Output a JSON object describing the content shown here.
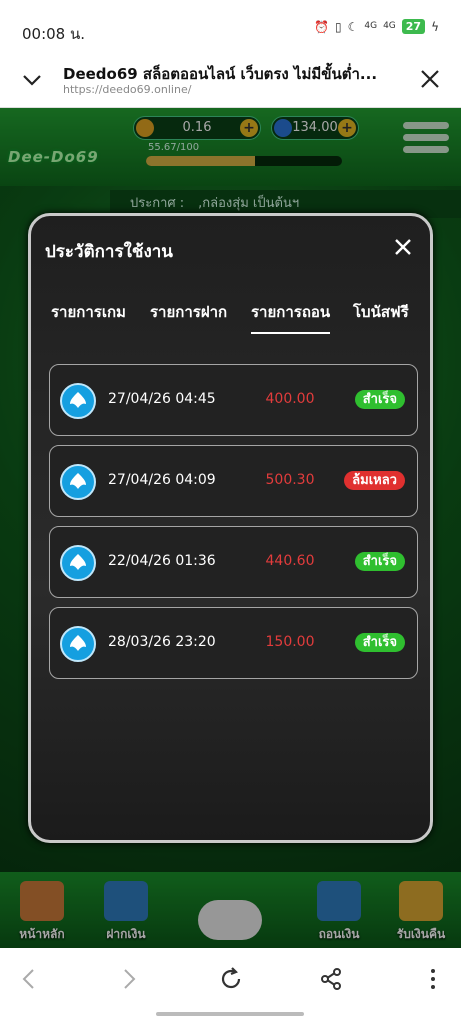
{
  "status_bar": {
    "time": "00:08 น.",
    "signal1": "4G",
    "signal2": "4G",
    "battery": "27"
  },
  "browser": {
    "page_title": "Deedo69 สล็อตออนไลน์ เว็บตรง ไม่มีขั้นต่ำ...",
    "url": "https://deedo69.online/"
  },
  "game": {
    "logo": "Dee-Do69",
    "credit": "0.16",
    "gems": "134.00",
    "exp_text": "55.67/100",
    "exp_fraction": 0.5567,
    "announce_label": "ประกาศ :",
    "announce_text": ",กล่องสุ่ม เป็นต้นฯ",
    "nav": [
      {
        "label": "หน้าหลัก",
        "icon": "house-icon"
      },
      {
        "label": "ฝากเงิน",
        "icon": "deposit-icon"
      },
      {
        "label": "ถอนเงิน",
        "icon": "withdraw-icon"
      },
      {
        "label": "รับเงินคืน",
        "icon": "cashback-icon"
      }
    ]
  },
  "modal": {
    "title": "ประวัติการใช้งาน",
    "tabs": [
      "รายการเกม",
      "รายการฝาก",
      "รายการถอน",
      "โบนัสฟรี"
    ],
    "active_tab": 2,
    "rows": [
      {
        "date": "27/04/26 04:45",
        "amount": "400.00",
        "status": "สำเร็จ",
        "status_type": "ok"
      },
      {
        "date": "27/04/26 04:09",
        "amount": "500.30",
        "status": "ล้มเหลว",
        "status_type": "fail"
      },
      {
        "date": "22/04/26 01:36",
        "amount": "440.60",
        "status": "สำเร็จ",
        "status_type": "ok"
      },
      {
        "date": "28/03/26 23:20",
        "amount": "150.00",
        "status": "สำเร็จ",
        "status_type": "ok"
      }
    ]
  },
  "colors": {
    "success": "#2fbf2f",
    "fail": "#e0302f",
    "amount": "#e23c3c",
    "bank": "#159fe0"
  }
}
